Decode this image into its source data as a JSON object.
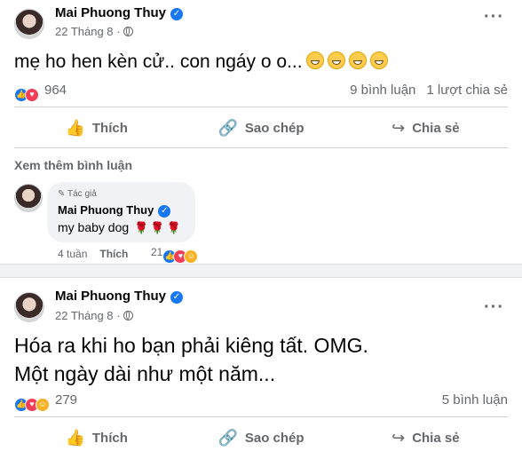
{
  "post1": {
    "author": "Mai Phuong Thuy",
    "date": "22 Tháng 8 ·",
    "text": "mẹ ho hen kèn cử.. con ngáy o o...",
    "reaction_count": "964",
    "comments": "9 bình luận",
    "shares": "1 lượt chia sẻ",
    "actions": {
      "like": "Thích",
      "copy": "Sao chép",
      "share": "Chia sẻ"
    },
    "see_more": "Xem thêm bình luận",
    "comment": {
      "tag": "Tác giả",
      "name": "Mai Phuong Thuy",
      "text": "my baby dog",
      "time": "4 tuần",
      "like": "Thích",
      "reaction_count": "21"
    }
  },
  "post2": {
    "author": "Mai Phuong Thuy",
    "date": "22 Tháng 8 ·",
    "line1": "Hóa ra khi ho bạn phải kiêng tất. OMG.",
    "line2": "Một ngày dài như một năm...",
    "reaction_count": "279",
    "comments": "5 bình luận",
    "actions": {
      "like": "Thích",
      "copy": "Sao chép",
      "share": "Chia sẻ"
    }
  },
  "colors": {
    "accent": "#1877f2",
    "love": "#f33e58",
    "muted": "#65676b"
  }
}
